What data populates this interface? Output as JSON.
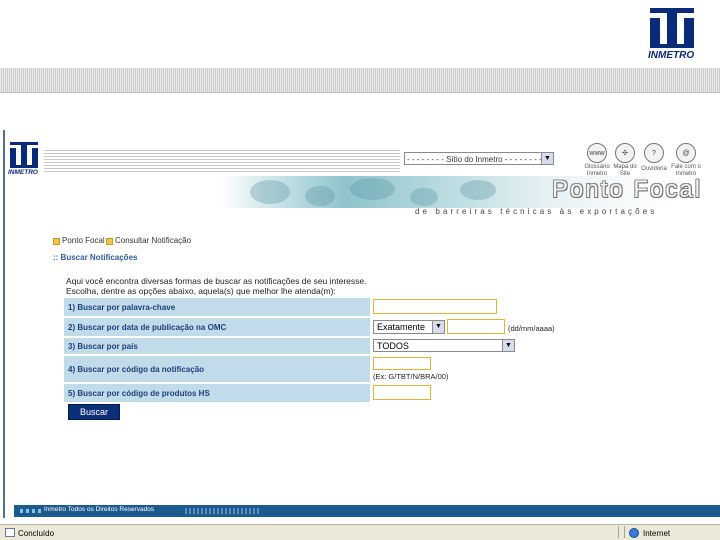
{
  "slide": {
    "logo_text": "INMETRO"
  },
  "site_header": {
    "logo_text": "INMETRO",
    "site_select": {
      "value": "- - - - - - - - Sítio do Inmetro - - - - - - - -"
    },
    "icons": [
      {
        "name": "www-icon",
        "glyph": "www",
        "label": "Glossário Inmetro"
      },
      {
        "name": "compass-icon",
        "glyph": "✣",
        "label": "Mapa do Site"
      },
      {
        "name": "question-icon",
        "glyph": "?",
        "label": "Ouvidoria"
      },
      {
        "name": "at-icon",
        "glyph": "@",
        "label": "Fale com o Inmetro"
      }
    ]
  },
  "banner": {
    "title": "Ponto Focal",
    "subtitle": "de barreiras técnicas às exportações"
  },
  "breadcrumb": {
    "items": [
      "Ponto Focal",
      "Consultar Notificação"
    ]
  },
  "section_title": ":: Buscar Notificações",
  "intro": {
    "line1": "Aqui você encontra diversas formas de buscar as notificações de seu interesse.",
    "line2": "Escolha, dentre as opções abaixo, aquela(s) que melhor lhe atenda(m):"
  },
  "search_form": {
    "row1_label": "1) Buscar por palavra-chave",
    "row2_label": "2) Buscar por data de publicação na OMC",
    "row2_select": "Exatamente",
    "row2_hint": "(dd/mm/aaaa)",
    "row3_label": "3) Buscar por país",
    "row3_select": "TODOS",
    "row4_label": "4) Buscar por código da notificação",
    "row4_hint": "(Ex: G/TBT/N/BRA/00)",
    "row5_label": "5) Buscar por código de produtos HS",
    "button_label": "Buscar"
  },
  "footer": {
    "text": "Inmetro Todos os Direitos Reservados"
  },
  "statusbar": {
    "status": "Concluído",
    "zone": "Internet"
  }
}
